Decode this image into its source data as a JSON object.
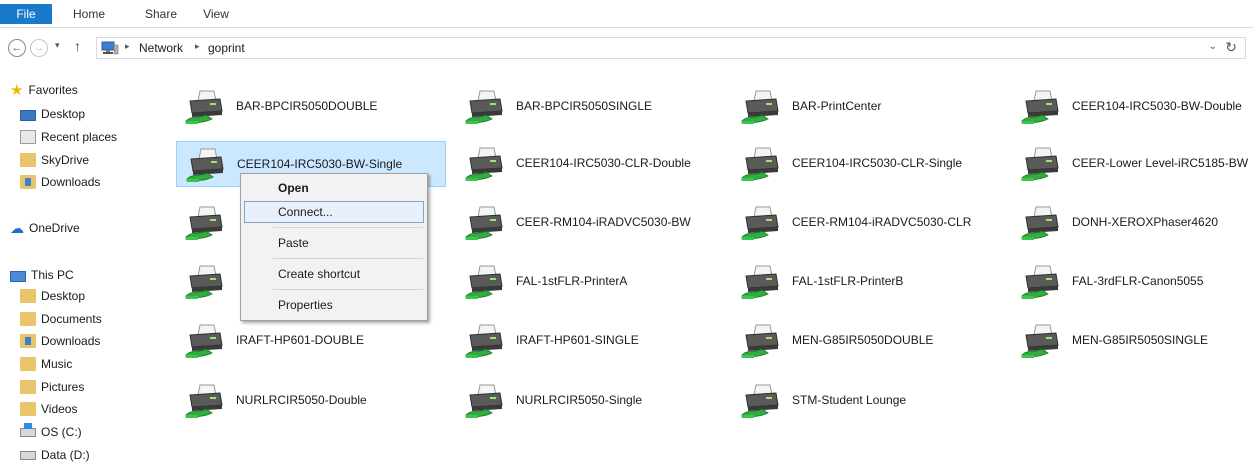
{
  "ribbon": {
    "tabs": [
      "File",
      "Home",
      "Share",
      "View"
    ]
  },
  "address": {
    "crumbs": [
      "Network",
      "goprint"
    ],
    "sep": "▸",
    "dropdown": "⌄",
    "refresh": "↻"
  },
  "nav": {
    "back": "←",
    "forward": "→",
    "recent": "▾",
    "up": "↑"
  },
  "sidebar": {
    "items": [
      {
        "label": "Favorites",
        "icon": "star-icon"
      },
      {
        "label": "Desktop",
        "icon": "desktop-icon"
      },
      {
        "label": "Recent places",
        "icon": "recent-places-icon"
      },
      {
        "label": "SkyDrive",
        "icon": "skydrive-folder-icon"
      },
      {
        "label": "Downloads",
        "icon": "downloads-folder-icon"
      },
      {
        "label": "OneDrive",
        "icon": "cloud-icon"
      },
      {
        "label": "This PC",
        "icon": "computer-icon"
      },
      {
        "label": "Desktop",
        "icon": "folder-icon"
      },
      {
        "label": "Documents",
        "icon": "documents-folder-icon"
      },
      {
        "label": "Downloads",
        "icon": "downloads-folder-icon"
      },
      {
        "label": "Music",
        "icon": "music-folder-icon"
      },
      {
        "label": "Pictures",
        "icon": "pictures-folder-icon"
      },
      {
        "label": "Videos",
        "icon": "videos-folder-icon"
      },
      {
        "label": "OS (C:)",
        "icon": "system-drive-icon"
      },
      {
        "label": "Data (D:)",
        "icon": "drive-icon"
      }
    ]
  },
  "printers": [
    "BAR-BPCIR5050DOUBLE",
    "BAR-BPCIR5050SINGLE",
    "BAR-PrintCenter",
    "CEER104-IRC5030-BW-Double",
    "CEER104-IRC5030-BW-Single",
    "CEER104-IRC5030-CLR-Double",
    "CEER104-IRC5030-CLR-Single",
    "CEER-Lower Level-iRC5185-BW",
    "",
    "CEER-RM104-iRADVC5030-BW",
    "CEER-RM104-iRADVC5030-CLR",
    "DONH-XEROXPhaser4620",
    "",
    "FAL-1stFLR-PrinterA",
    "FAL-1stFLR-PrinterB",
    "FAL-3rdFLR-Canon5055",
    "IRAFT-HP601-DOUBLE",
    "IRAFT-HP601-SINGLE",
    "MEN-G85IR5050DOUBLE",
    "MEN-G85IR5050SINGLE",
    "NURLRCIR5050-Double",
    "NURLRCIR5050-Single",
    "STM-Student Lounge"
  ],
  "selected_printer": "CEER104-IRC5030-BW-Single",
  "context_menu": {
    "items": [
      "Open",
      "Connect...",
      "Paste",
      "Create shortcut",
      "Properties"
    ]
  },
  "colors": {
    "accent": "#1979ca",
    "selection": "#cce8ff",
    "selection_border": "#99d1ff"
  }
}
